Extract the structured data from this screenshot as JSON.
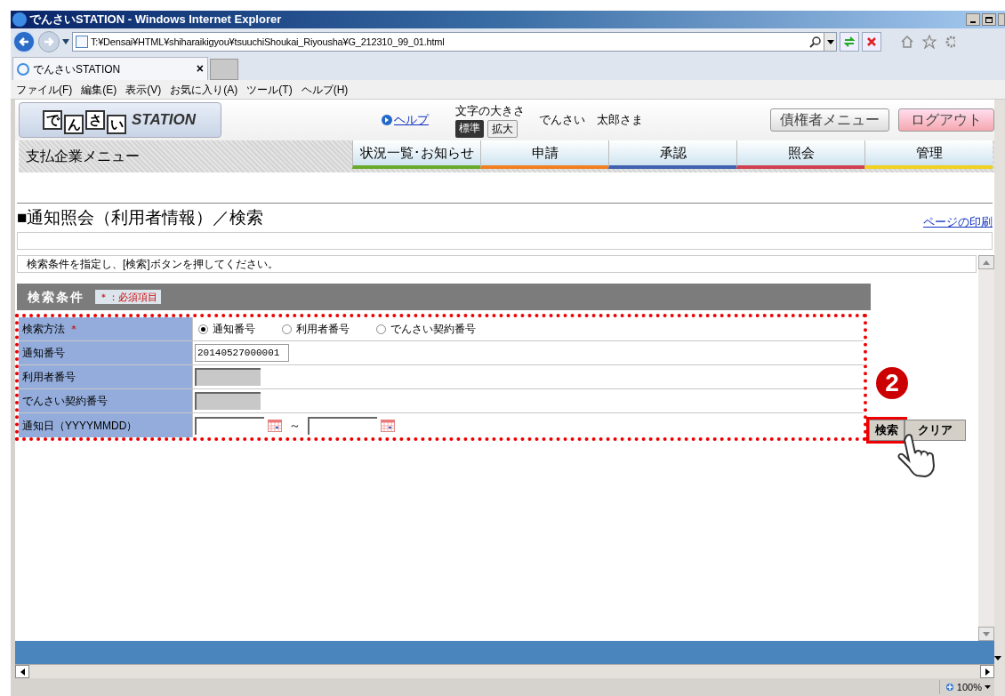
{
  "window": {
    "title": "でんさいSTATION - Windows Internet Explorer"
  },
  "address": {
    "url": "T:¥Densai¥HTML¥shiharaikigyou¥tsuuchiShoukai_Riyousha¥G_212310_99_01.html"
  },
  "browser_tab": {
    "title": "でんさいSTATION",
    "close": "×"
  },
  "menu": [
    "ファイル(F)",
    "編集(E)",
    "表示(V)",
    "お気に入り(A)",
    "ツール(T)",
    "ヘルプ(H)"
  ],
  "header": {
    "logo_chars": [
      "で",
      "ん",
      "さ",
      "い"
    ],
    "logo_word": "STATION",
    "help": "ヘルプ",
    "font_size_label": "文字の大きさ",
    "font_sizes": [
      {
        "label": "標準",
        "selected": true
      },
      {
        "label": "拡大",
        "selected": false
      }
    ],
    "user": "でんさい　太郎さま",
    "buttons": [
      {
        "label": "債権者メニュー",
        "kind": "plain"
      },
      {
        "label": "ログアウト",
        "kind": "logout"
      }
    ]
  },
  "nav": {
    "menu_label": "支払企業メニュー",
    "tabs": [
      {
        "label": "状況一覧･お知らせ",
        "color": "#6aaa2a"
      },
      {
        "label": "申請",
        "color": "#f08020"
      },
      {
        "label": "承認",
        "color": "#4060b0"
      },
      {
        "label": "照会",
        "color": "#d04050"
      },
      {
        "label": "管理",
        "color": "#f0d020"
      }
    ]
  },
  "page": {
    "title": "■通知照会（利用者情報）／検索",
    "print_link": "ページの印刷",
    "instruction": "検索条件を指定し、[検索]ボタンを押してください。"
  },
  "search": {
    "heading": "検索条件",
    "required_note": "＊：必須項目",
    "rows": [
      {
        "kind": "radio",
        "label": "検索方法",
        "required_mark": "＊",
        "options": [
          {
            "label": "通知番号",
            "selected": true
          },
          {
            "label": "利用者番号",
            "selected": false
          },
          {
            "label": "でんさい契約番号",
            "selected": false
          }
        ]
      },
      {
        "kind": "text",
        "label": "通知番号",
        "value": "20140527000001",
        "disabled": false
      },
      {
        "kind": "text",
        "label": "利用者番号",
        "disabled": true
      },
      {
        "kind": "text",
        "label": "でんさい契約番号",
        "disabled": true
      },
      {
        "kind": "date_range",
        "label": "通知日（YYYYMMDD）",
        "separator": "～"
      }
    ],
    "buttons": [
      {
        "label": "検索",
        "highlighted": true
      },
      {
        "label": "クリア",
        "highlighted": false
      }
    ],
    "step": "2"
  },
  "status_bar": {
    "zoom": "100%"
  }
}
